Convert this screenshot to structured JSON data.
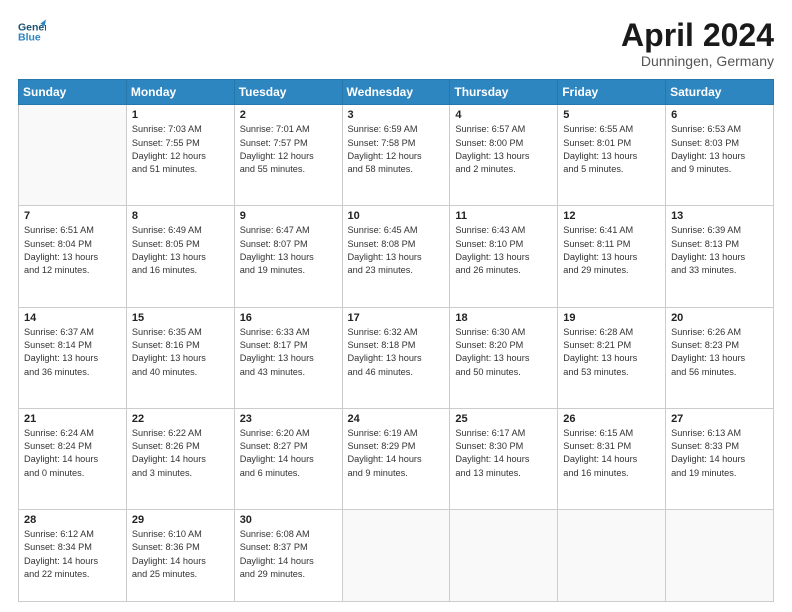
{
  "header": {
    "logo_line1": "General",
    "logo_line2": "Blue",
    "month": "April 2024",
    "location": "Dunningen, Germany"
  },
  "weekdays": [
    "Sunday",
    "Monday",
    "Tuesday",
    "Wednesday",
    "Thursday",
    "Friday",
    "Saturday"
  ],
  "weeks": [
    [
      {
        "day": "",
        "lines": []
      },
      {
        "day": "1",
        "lines": [
          "Sunrise: 7:03 AM",
          "Sunset: 7:55 PM",
          "Daylight: 12 hours",
          "and 51 minutes."
        ]
      },
      {
        "day": "2",
        "lines": [
          "Sunrise: 7:01 AM",
          "Sunset: 7:57 PM",
          "Daylight: 12 hours",
          "and 55 minutes."
        ]
      },
      {
        "day": "3",
        "lines": [
          "Sunrise: 6:59 AM",
          "Sunset: 7:58 PM",
          "Daylight: 12 hours",
          "and 58 minutes."
        ]
      },
      {
        "day": "4",
        "lines": [
          "Sunrise: 6:57 AM",
          "Sunset: 8:00 PM",
          "Daylight: 13 hours",
          "and 2 minutes."
        ]
      },
      {
        "day": "5",
        "lines": [
          "Sunrise: 6:55 AM",
          "Sunset: 8:01 PM",
          "Daylight: 13 hours",
          "and 5 minutes."
        ]
      },
      {
        "day": "6",
        "lines": [
          "Sunrise: 6:53 AM",
          "Sunset: 8:03 PM",
          "Daylight: 13 hours",
          "and 9 minutes."
        ]
      }
    ],
    [
      {
        "day": "7",
        "lines": [
          "Sunrise: 6:51 AM",
          "Sunset: 8:04 PM",
          "Daylight: 13 hours",
          "and 12 minutes."
        ]
      },
      {
        "day": "8",
        "lines": [
          "Sunrise: 6:49 AM",
          "Sunset: 8:05 PM",
          "Daylight: 13 hours",
          "and 16 minutes."
        ]
      },
      {
        "day": "9",
        "lines": [
          "Sunrise: 6:47 AM",
          "Sunset: 8:07 PM",
          "Daylight: 13 hours",
          "and 19 minutes."
        ]
      },
      {
        "day": "10",
        "lines": [
          "Sunrise: 6:45 AM",
          "Sunset: 8:08 PM",
          "Daylight: 13 hours",
          "and 23 minutes."
        ]
      },
      {
        "day": "11",
        "lines": [
          "Sunrise: 6:43 AM",
          "Sunset: 8:10 PM",
          "Daylight: 13 hours",
          "and 26 minutes."
        ]
      },
      {
        "day": "12",
        "lines": [
          "Sunrise: 6:41 AM",
          "Sunset: 8:11 PM",
          "Daylight: 13 hours",
          "and 29 minutes."
        ]
      },
      {
        "day": "13",
        "lines": [
          "Sunrise: 6:39 AM",
          "Sunset: 8:13 PM",
          "Daylight: 13 hours",
          "and 33 minutes."
        ]
      }
    ],
    [
      {
        "day": "14",
        "lines": [
          "Sunrise: 6:37 AM",
          "Sunset: 8:14 PM",
          "Daylight: 13 hours",
          "and 36 minutes."
        ]
      },
      {
        "day": "15",
        "lines": [
          "Sunrise: 6:35 AM",
          "Sunset: 8:16 PM",
          "Daylight: 13 hours",
          "and 40 minutes."
        ]
      },
      {
        "day": "16",
        "lines": [
          "Sunrise: 6:33 AM",
          "Sunset: 8:17 PM",
          "Daylight: 13 hours",
          "and 43 minutes."
        ]
      },
      {
        "day": "17",
        "lines": [
          "Sunrise: 6:32 AM",
          "Sunset: 8:18 PM",
          "Daylight: 13 hours",
          "and 46 minutes."
        ]
      },
      {
        "day": "18",
        "lines": [
          "Sunrise: 6:30 AM",
          "Sunset: 8:20 PM",
          "Daylight: 13 hours",
          "and 50 minutes."
        ]
      },
      {
        "day": "19",
        "lines": [
          "Sunrise: 6:28 AM",
          "Sunset: 8:21 PM",
          "Daylight: 13 hours",
          "and 53 minutes."
        ]
      },
      {
        "day": "20",
        "lines": [
          "Sunrise: 6:26 AM",
          "Sunset: 8:23 PM",
          "Daylight: 13 hours",
          "and 56 minutes."
        ]
      }
    ],
    [
      {
        "day": "21",
        "lines": [
          "Sunrise: 6:24 AM",
          "Sunset: 8:24 PM",
          "Daylight: 14 hours",
          "and 0 minutes."
        ]
      },
      {
        "day": "22",
        "lines": [
          "Sunrise: 6:22 AM",
          "Sunset: 8:26 PM",
          "Daylight: 14 hours",
          "and 3 minutes."
        ]
      },
      {
        "day": "23",
        "lines": [
          "Sunrise: 6:20 AM",
          "Sunset: 8:27 PM",
          "Daylight: 14 hours",
          "and 6 minutes."
        ]
      },
      {
        "day": "24",
        "lines": [
          "Sunrise: 6:19 AM",
          "Sunset: 8:29 PM",
          "Daylight: 14 hours",
          "and 9 minutes."
        ]
      },
      {
        "day": "25",
        "lines": [
          "Sunrise: 6:17 AM",
          "Sunset: 8:30 PM",
          "Daylight: 14 hours",
          "and 13 minutes."
        ]
      },
      {
        "day": "26",
        "lines": [
          "Sunrise: 6:15 AM",
          "Sunset: 8:31 PM",
          "Daylight: 14 hours",
          "and 16 minutes."
        ]
      },
      {
        "day": "27",
        "lines": [
          "Sunrise: 6:13 AM",
          "Sunset: 8:33 PM",
          "Daylight: 14 hours",
          "and 19 minutes."
        ]
      }
    ],
    [
      {
        "day": "28",
        "lines": [
          "Sunrise: 6:12 AM",
          "Sunset: 8:34 PM",
          "Daylight: 14 hours",
          "and 22 minutes."
        ]
      },
      {
        "day": "29",
        "lines": [
          "Sunrise: 6:10 AM",
          "Sunset: 8:36 PM",
          "Daylight: 14 hours",
          "and 25 minutes."
        ]
      },
      {
        "day": "30",
        "lines": [
          "Sunrise: 6:08 AM",
          "Sunset: 8:37 PM",
          "Daylight: 14 hours",
          "and 29 minutes."
        ]
      },
      {
        "day": "",
        "lines": []
      },
      {
        "day": "",
        "lines": []
      },
      {
        "day": "",
        "lines": []
      },
      {
        "day": "",
        "lines": []
      }
    ]
  ]
}
